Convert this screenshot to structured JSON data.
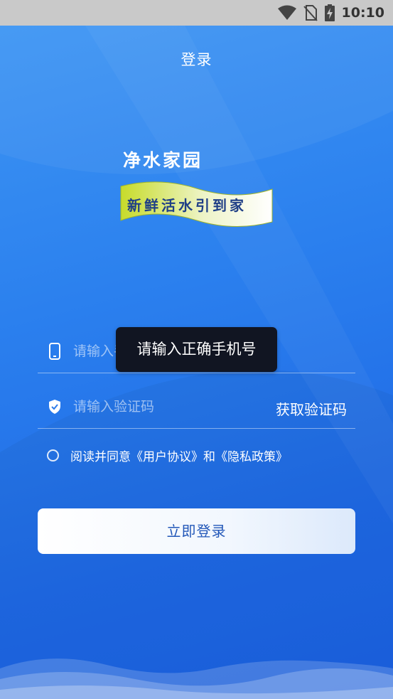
{
  "status_bar": {
    "time": "10:10"
  },
  "header": {
    "title": "登录"
  },
  "logo": {
    "title": "净水家园",
    "slogan": "新鲜活水引到家"
  },
  "form": {
    "phone_placeholder": "请输入手机号",
    "phone_visible_prefix": "请输入",
    "code_placeholder": "请输入验证码",
    "get_code_label": "获取验证码"
  },
  "agreement": {
    "prefix": "阅读并同意",
    "user_agreement": "《用户协议》",
    "and": "和",
    "privacy_policy": "《隐私政策》"
  },
  "login_button": {
    "label": "立即登录"
  },
  "toast": {
    "message": "请输入正确手机号"
  },
  "colors": {
    "background_top": "#3f97f4",
    "background_bottom": "#1b60e2",
    "status_bar": "#c9c9c9",
    "toast_bg": "#111522",
    "button_text": "#2257b8"
  },
  "icons": [
    "wifi-icon",
    "no-sim-icon",
    "battery-charging-icon",
    "phone-icon",
    "shield-check-icon",
    "radio-unchecked-icon"
  ]
}
